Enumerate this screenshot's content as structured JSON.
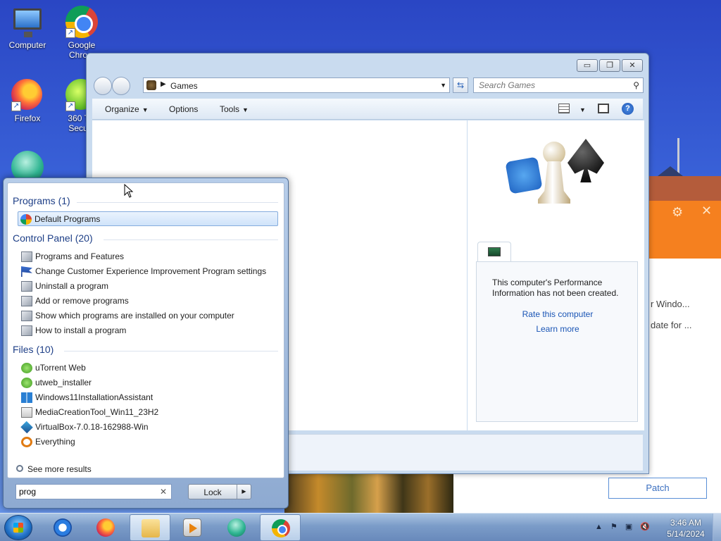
{
  "desktop": {
    "icons": [
      {
        "label": "Computer"
      },
      {
        "label": "Google Chro..."
      },
      {
        "label": "Firefox"
      },
      {
        "label": "360 T... Secu..."
      }
    ]
  },
  "explorer": {
    "address": "Games",
    "search_placeholder": "Search Games",
    "toolbar": {
      "organize": "Organize",
      "options": "Options",
      "tools": "Tools"
    },
    "details": {
      "perf_message": "This computer's Performance Information has not been created.",
      "rate_link": "Rate this computer",
      "learn_link": "Learn more"
    }
  },
  "background_app": {
    "line1": "r Windo...",
    "line2": "date for ...",
    "patch_button": "Patch"
  },
  "start_menu": {
    "programs_header": "Programs (1)",
    "programs": [
      {
        "label": "Default Programs",
        "icon": "default-programs-icon"
      }
    ],
    "control_panel_header": "Control Panel (20)",
    "control_panel": [
      {
        "label": "Programs and Features",
        "icon": "control-panel-icon"
      },
      {
        "label": "Change Customer Experience Improvement Program settings",
        "icon": "flag-icon"
      },
      {
        "label": "Uninstall a program",
        "icon": "control-panel-icon"
      },
      {
        "label": "Add or remove programs",
        "icon": "control-panel-icon"
      },
      {
        "label": "Show which programs are installed on your computer",
        "icon": "control-panel-icon"
      },
      {
        "label": "How to install a program",
        "icon": "control-panel-icon"
      }
    ],
    "files_header": "Files (10)",
    "files": [
      {
        "label": "uTorrent Web",
        "icon": "utorrent-icon"
      },
      {
        "label": "utweb_installer",
        "icon": "utorrent-icon"
      },
      {
        "label": "Windows11InstallationAssistant",
        "icon": "windows-icon"
      },
      {
        "label": "MediaCreationTool_Win11_23H2",
        "icon": "media-tool-icon"
      },
      {
        "label": "VirtualBox-7.0.18-162988-Win",
        "icon": "virtualbox-icon"
      },
      {
        "label": "Everything",
        "icon": "everything-icon"
      }
    ],
    "see_more": "See more results",
    "search_value": "prog",
    "lock_label": "Lock"
  },
  "taskbar": {
    "time": "3:46 AM",
    "date": "5/14/2024"
  }
}
